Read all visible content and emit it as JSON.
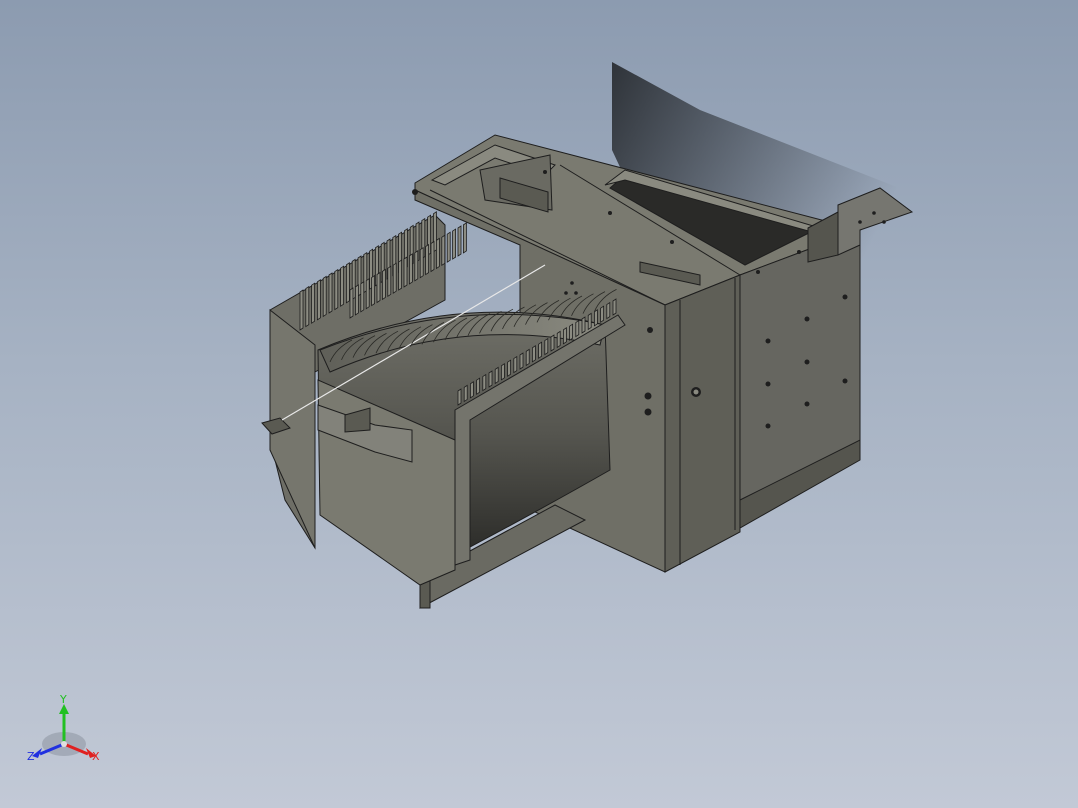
{
  "viewport": {
    "background_top": "#8c9bb0",
    "background_bottom": "#c2c9d6",
    "model_color": "#6b6b60",
    "edge_color": "#1e1e1e"
  },
  "triad": {
    "x_label": "X",
    "y_label": "Y",
    "z_label": "Z",
    "x_color": "#e02020",
    "y_color": "#22c022",
    "z_color": "#2030e0"
  }
}
